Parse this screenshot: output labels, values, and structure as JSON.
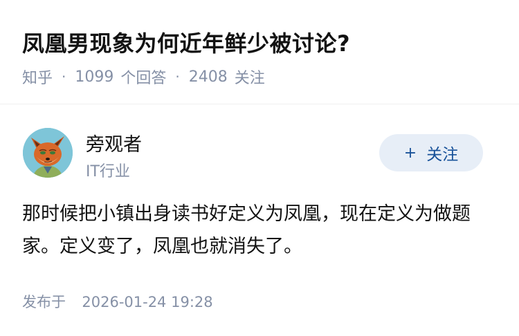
{
  "question": {
    "title": "凤凰男现象为何近年鲜少被讨论?",
    "source": "知乎",
    "answer_count": "1099",
    "answer_unit": "个回答",
    "follower_count": "2408",
    "follower_unit": "关注"
  },
  "author": {
    "name": "旁观者",
    "headline": "IT行业",
    "avatar_icon": "fox-avatar-icon"
  },
  "follow_button": {
    "plus": "+",
    "label": "关注",
    "color": "#175199",
    "background": "#e7eef7"
  },
  "answer": {
    "content": "那时候把小镇出身读书好定义为凤凰，现在定义为做题家。定义变了，凤凰也就消失了。"
  },
  "publish": {
    "prefix": "发布于",
    "timestamp": "2026-01-24 19:28"
  }
}
